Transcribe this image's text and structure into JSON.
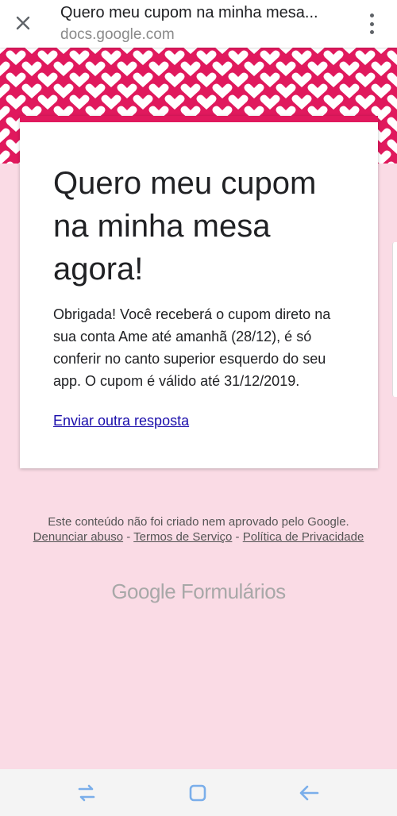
{
  "browser": {
    "page_title": "Quero meu cupom na minha mesa...",
    "url": "docs.google.com"
  },
  "form": {
    "title": "Quero meu cupom na minha mesa agora!",
    "confirmation": "Obrigada! Você receberá o cupom direto na sua conta Ame até amanhã (28/12), é só conferir no canto superior esquerdo do seu app. O cupom é válido até 31/12/2019.",
    "another_response": "Enviar outra resposta"
  },
  "footer": {
    "disclaimer": "Este conteúdo não foi criado nem aprovado pelo Google.",
    "report_abuse": "Denunciar abuso",
    "separator": " - ",
    "terms": "Termos de Serviço",
    "privacy": "Política de Privacidade",
    "brand_google": "Google",
    "brand_forms": "Formulários"
  },
  "colors": {
    "accent": "#e0195d",
    "background": "#fadbe5",
    "link": "#1a0dab",
    "nav_icon": "#7aaeea"
  },
  "icons": [
    "close-icon",
    "more-vert-icon",
    "recent-apps-icon",
    "home-icon",
    "back-icon"
  ]
}
